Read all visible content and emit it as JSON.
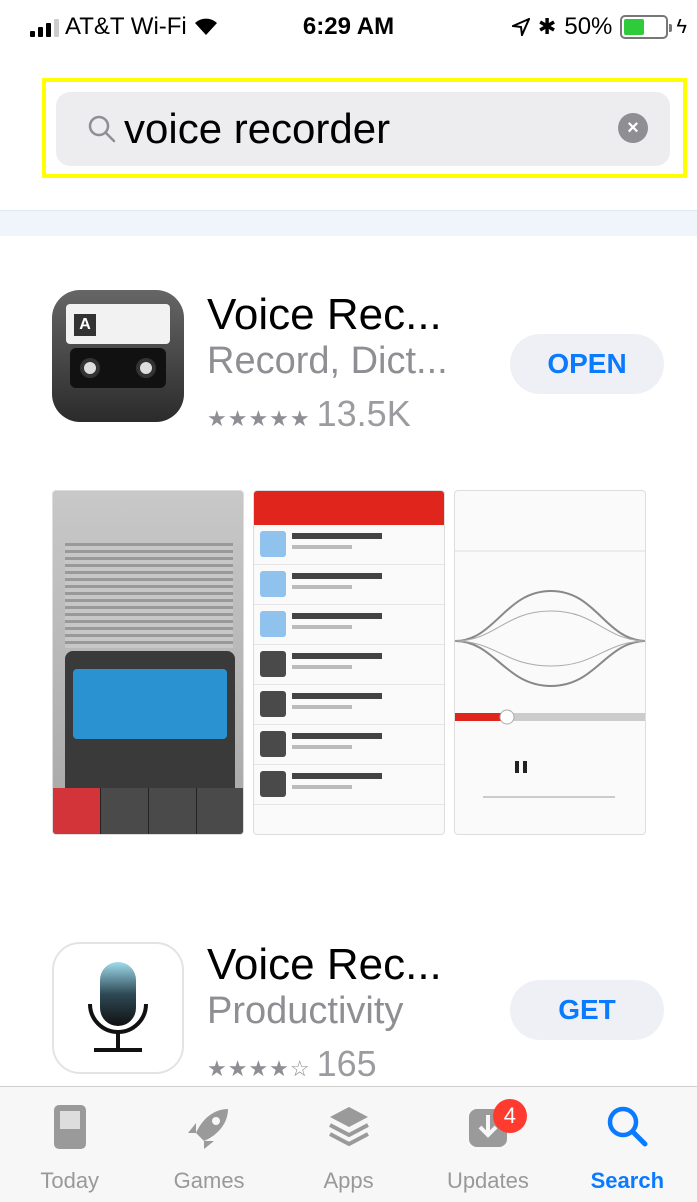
{
  "status_bar": {
    "carrier": "AT&T Wi-Fi",
    "time": "6:29 AM",
    "battery": "50%",
    "battery_level": 0.5
  },
  "search": {
    "query": "voice recorder"
  },
  "results": [
    {
      "title": "Voice Rec...",
      "subtitle": "Record, Dict...",
      "stars": "★★★★★",
      "rating_count": "13.5K",
      "button": "OPEN"
    },
    {
      "title": "Voice Rec...",
      "subtitle": "Productivity",
      "stars": "★★★★☆",
      "rating_count": "165",
      "button": "GET"
    }
  ],
  "tabbar": {
    "items": [
      {
        "label": "Today",
        "icon": "today-icon"
      },
      {
        "label": "Games",
        "icon": "rocket-icon"
      },
      {
        "label": "Apps",
        "icon": "layers-icon"
      },
      {
        "label": "Updates",
        "icon": "download-icon",
        "badge": "4"
      },
      {
        "label": "Search",
        "icon": "search-icon"
      }
    ]
  },
  "colors": {
    "accent": "#0a7aff",
    "highlight": "#ffff00",
    "badge": "#ff3b30"
  }
}
